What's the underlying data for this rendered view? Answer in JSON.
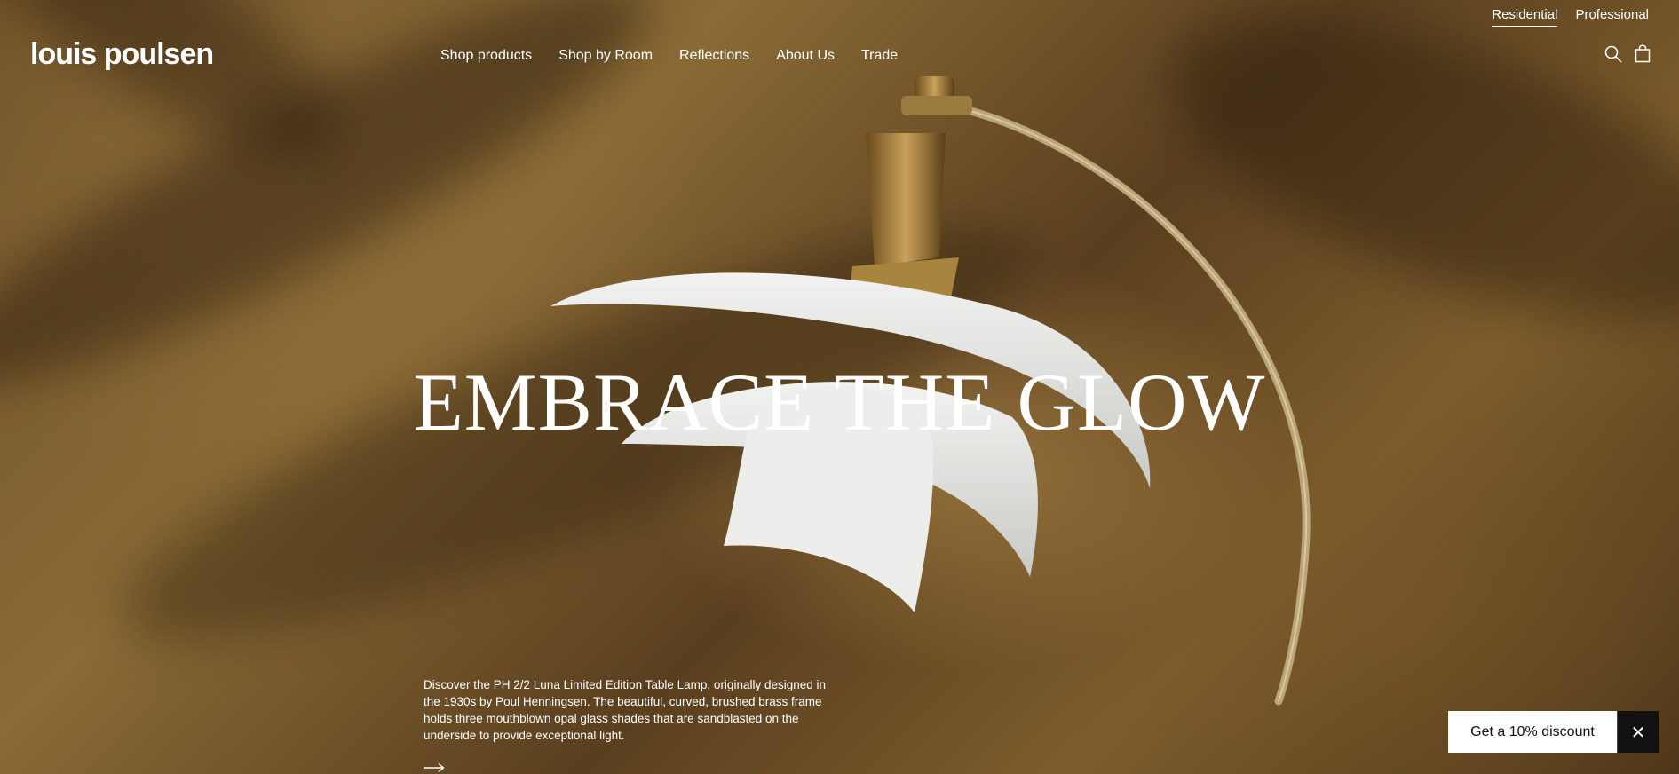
{
  "brand": {
    "logo": "louis poulsen"
  },
  "segment_switch": [
    {
      "label": "Residential",
      "active": true
    },
    {
      "label": "Professional",
      "active": false
    }
  ],
  "nav": {
    "items": [
      {
        "label": "Shop products"
      },
      {
        "label": "Shop by Room"
      },
      {
        "label": "Reflections"
      },
      {
        "label": "About Us"
      },
      {
        "label": "Trade"
      }
    ]
  },
  "header_icons": [
    "search-icon",
    "shopping-bag-icon"
  ],
  "hero": {
    "headline": "EMBRACE THE GLOW",
    "description": "Discover the PH 2/2 Luna Limited Edition Table Lamp, originally designed in the 1930s by Poul Henningsen. The beautiful, curved, brushed brass frame holds three mouthblown opal glass shades that are sandblasted on the underside to provide exceptional light."
  },
  "discount": {
    "label": "Get a 10% discount",
    "close": "✕"
  },
  "colors": {
    "text": "#ffffff",
    "sand": "#8a6a35",
    "dark": "#111111"
  }
}
